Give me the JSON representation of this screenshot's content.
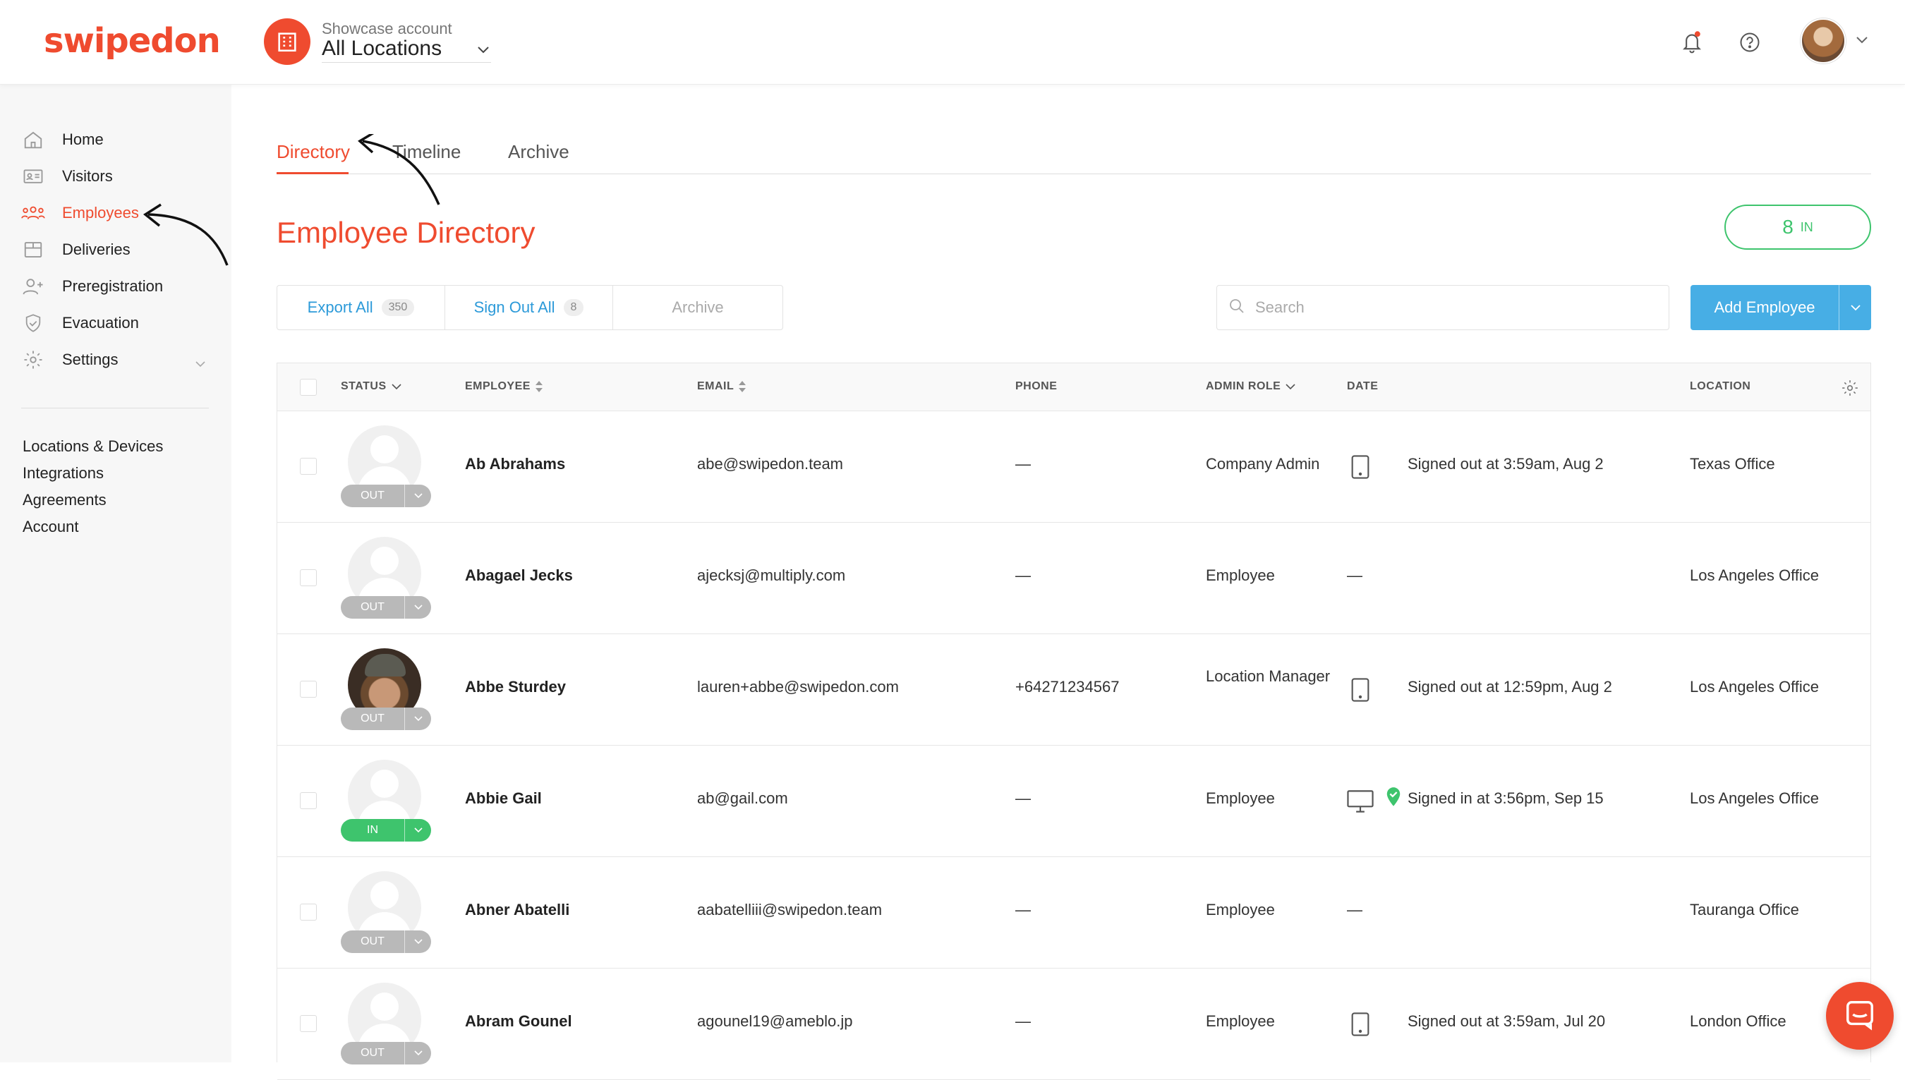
{
  "brand": {
    "logo": "swipedon",
    "accent": "#ef4b2f"
  },
  "header": {
    "account_label": "Showcase account",
    "account_value": "All Locations"
  },
  "sidebar": {
    "items": [
      {
        "label": "Home",
        "icon": "home-icon"
      },
      {
        "label": "Visitors",
        "icon": "visitors-icon"
      },
      {
        "label": "Employees",
        "icon": "employees-icon",
        "active": true
      },
      {
        "label": "Deliveries",
        "icon": "deliveries-icon"
      },
      {
        "label": "Preregistration",
        "icon": "preregistration-icon"
      },
      {
        "label": "Evacuation",
        "icon": "shield-icon"
      },
      {
        "label": "Settings",
        "icon": "gear-icon"
      }
    ],
    "links": [
      "Locations & Devices",
      "Integrations",
      "Agreements",
      "Account"
    ]
  },
  "tabs": [
    "Directory",
    "Timeline",
    "Archive"
  ],
  "page_title": "Employee Directory",
  "in_count": {
    "number": "8",
    "label": "IN"
  },
  "toolbar": {
    "export_label": "Export All",
    "export_count": "350",
    "signout_label": "Sign Out All",
    "signout_count": "8",
    "archive_label": "Archive",
    "search_placeholder": "Search",
    "add_label": "Add Employee"
  },
  "table": {
    "columns": [
      "STATUS",
      "EMPLOYEE",
      "EMAIL",
      "PHONE",
      "ADMIN ROLE",
      "DATE",
      "LOCATION"
    ],
    "rows": [
      {
        "status": "OUT",
        "name": "Ab Abrahams",
        "email": "abe@swipedon.team",
        "phone": "—",
        "role": "Company Admin",
        "device": "tablet-icon",
        "date": "Signed out at 3:59am, Aug 2",
        "location": "Texas Office"
      },
      {
        "status": "OUT",
        "name": "Abagael Jecks",
        "email": "ajecksj@multiply.com",
        "phone": "—",
        "role": "Employee",
        "device": "",
        "date": "—",
        "location": "Los Angeles Office"
      },
      {
        "status": "OUT",
        "name": "Abbe Sturdey",
        "email": "lauren+abbe@swipedon.com",
        "phone": "+64271234567",
        "role": "Location Manager",
        "device": "tablet-icon",
        "date": "Signed out at 12:59pm, Aug 2",
        "location": "Los Angeles Office"
      },
      {
        "status": "IN",
        "name": "Abbie Gail",
        "email": "ab@gail.com",
        "phone": "—",
        "role": "Employee",
        "device": "monitor-icon",
        "date": "Signed in at 3:56pm, Sep 15",
        "location": "Los Angeles Office"
      },
      {
        "status": "OUT",
        "name": "Abner Abatelli",
        "email": "aabatelliii@swipedon.team",
        "phone": "—",
        "role": "Employee",
        "device": "",
        "date": "—",
        "location": "Tauranga Office"
      },
      {
        "status": "OUT",
        "name": "Abram Gounel",
        "email": "agounel19@ameblo.jp",
        "phone": "—",
        "role": "Employee",
        "device": "tablet-icon",
        "date": "Signed out at 3:59am, Jul 20",
        "location": "London Office"
      }
    ]
  }
}
